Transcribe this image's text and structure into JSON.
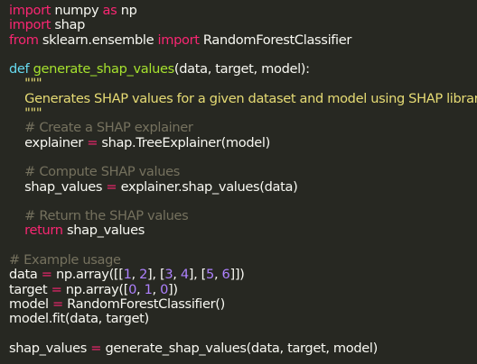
{
  "editor": {
    "theme": {
      "background": "#272822",
      "foreground": "#f8f8f2",
      "keyword": "#f92672",
      "function": "#a6e22e",
      "string": "#e6db74",
      "comment": "#75715e",
      "number": "#ae81ff",
      "def_keyword": "#66d9ef"
    },
    "lines": [
      [
        {
          "t": "import",
          "c": "kw"
        },
        {
          "t": " numpy "
        },
        {
          "t": "as",
          "c": "kw"
        },
        {
          "t": " np"
        }
      ],
      [
        {
          "t": "import",
          "c": "kw"
        },
        {
          "t": " shap"
        }
      ],
      [
        {
          "t": "from",
          "c": "kw"
        },
        {
          "t": " sklearn.ensemble "
        },
        {
          "t": "import",
          "c": "kw"
        },
        {
          "t": " RandomForestClassifier"
        }
      ],
      [],
      [
        {
          "t": "def",
          "c": "def"
        },
        {
          "t": " "
        },
        {
          "t": "generate_shap_values",
          "c": "fn"
        },
        {
          "t": "(data, target, model):"
        }
      ],
      [
        {
          "t": "    "
        },
        {
          "t": "\"\"\"",
          "c": "str"
        }
      ],
      [
        {
          "t": "    "
        },
        {
          "t": "Generates SHAP values for a given dataset and model using SHAP library.",
          "c": "str"
        }
      ],
      [
        {
          "t": "    "
        },
        {
          "t": "\"\"\"",
          "c": "str"
        }
      ],
      [
        {
          "t": "    "
        },
        {
          "t": "# Create a SHAP explainer",
          "c": "cm"
        }
      ],
      [
        {
          "t": "    explainer "
        },
        {
          "t": "=",
          "c": "op"
        },
        {
          "t": " shap.TreeExplainer(model)"
        }
      ],
      [],
      [
        {
          "t": "    "
        },
        {
          "t": "# Compute SHAP values",
          "c": "cm"
        }
      ],
      [
        {
          "t": "    shap_values "
        },
        {
          "t": "=",
          "c": "op"
        },
        {
          "t": " explainer.shap_values(data)"
        }
      ],
      [],
      [
        {
          "t": "    "
        },
        {
          "t": "# Return the SHAP values",
          "c": "cm"
        }
      ],
      [
        {
          "t": "    "
        },
        {
          "t": "return",
          "c": "kw"
        },
        {
          "t": " shap_values"
        }
      ],
      [],
      [
        {
          "t": "# Example usage",
          "c": "cm"
        }
      ],
      [
        {
          "t": "data "
        },
        {
          "t": "=",
          "c": "op"
        },
        {
          "t": " np.array([["
        },
        {
          "t": "1",
          "c": "num"
        },
        {
          "t": ", "
        },
        {
          "t": "2",
          "c": "num"
        },
        {
          "t": "], ["
        },
        {
          "t": "3",
          "c": "num"
        },
        {
          "t": ", "
        },
        {
          "t": "4",
          "c": "num"
        },
        {
          "t": "], ["
        },
        {
          "t": "5",
          "c": "num"
        },
        {
          "t": ", "
        },
        {
          "t": "6",
          "c": "num"
        },
        {
          "t": "]])"
        }
      ],
      [
        {
          "t": "target "
        },
        {
          "t": "=",
          "c": "op"
        },
        {
          "t": " np.array(["
        },
        {
          "t": "0",
          "c": "num"
        },
        {
          "t": ", "
        },
        {
          "t": "1",
          "c": "num"
        },
        {
          "t": ", "
        },
        {
          "t": "0",
          "c": "num"
        },
        {
          "t": "])"
        }
      ],
      [
        {
          "t": "model "
        },
        {
          "t": "=",
          "c": "op"
        },
        {
          "t": " RandomForestClassifier()"
        }
      ],
      [
        {
          "t": "model.fit(data, target)"
        }
      ],
      [],
      [
        {
          "t": "shap_values "
        },
        {
          "t": "=",
          "c": "op"
        },
        {
          "t": " generate_shap_values(data, target, model)"
        }
      ]
    ]
  }
}
